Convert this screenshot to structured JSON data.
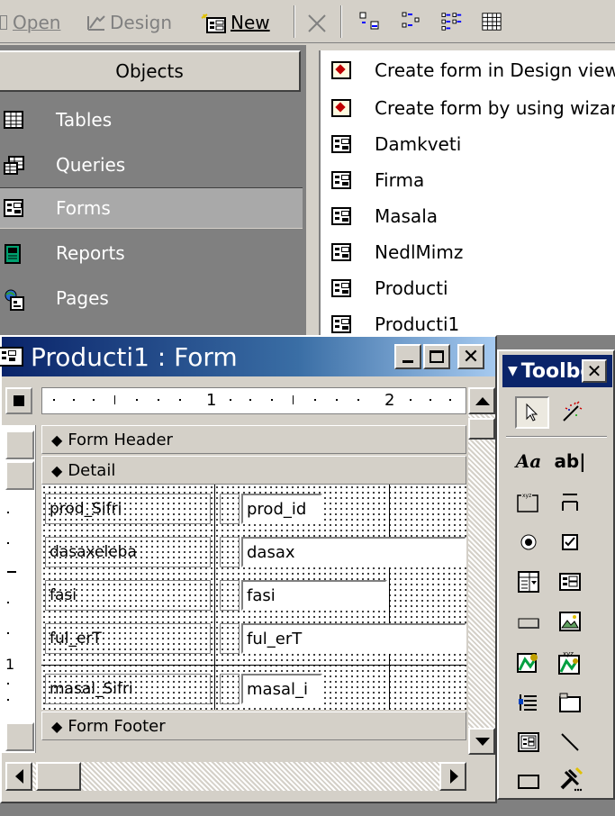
{
  "toolbar": {
    "open_label": "Open",
    "design_label": "Design",
    "new_label": "New"
  },
  "objects": {
    "header": "Objects",
    "items": [
      {
        "label": "Tables",
        "icon": "table-icon"
      },
      {
        "label": "Queries",
        "icon": "query-icon"
      },
      {
        "label": "Forms",
        "icon": "form-icon",
        "selected": true
      },
      {
        "label": "Reports",
        "icon": "report-icon"
      },
      {
        "label": "Pages",
        "icon": "page-icon"
      }
    ]
  },
  "object_list": {
    "items": [
      {
        "label": "Create form in Design view",
        "icon": "wizard-icon"
      },
      {
        "label": "Create form by using wizard",
        "icon": "wizard-icon"
      },
      {
        "label": "Damkveti",
        "icon": "form-icon"
      },
      {
        "label": "Firma",
        "icon": "form-icon"
      },
      {
        "label": "Masala",
        "icon": "form-icon"
      },
      {
        "label": "NedlMimz",
        "icon": "form-icon"
      },
      {
        "label": "Producti",
        "icon": "form-icon"
      },
      {
        "label": "Producti1",
        "icon": "form-icon"
      }
    ]
  },
  "form_window": {
    "title": "Producti1 : Form",
    "ruler_marks": [
      "1",
      "2"
    ],
    "vertical_ruler_mark": "1",
    "sections": {
      "header": "Form Header",
      "detail": "Detail",
      "footer": "Form Footer"
    },
    "fields": [
      {
        "label": "prod_Sifri",
        "control": "prod_id"
      },
      {
        "label": "dasaxeleba",
        "control": "dasax"
      },
      {
        "label": "fasi",
        "control": "fasi"
      },
      {
        "label": "ful_erT",
        "control": "ful_erT"
      },
      {
        "label": "masal_Sifri",
        "control": "masal_i"
      }
    ]
  },
  "toolbox": {
    "title": "Toolbox",
    "label_tool": "Aa",
    "textbox_tool": "ab|"
  }
}
